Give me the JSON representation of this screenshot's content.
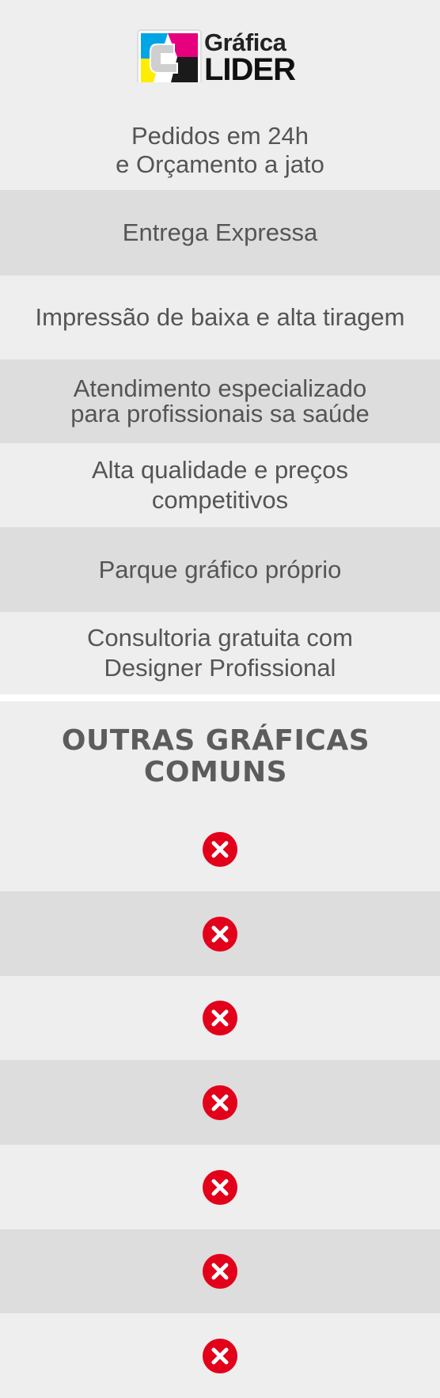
{
  "logo": {
    "line1": "Gráfica",
    "line2": "LIDER",
    "colors": {
      "cyan": "#00a5e3",
      "magenta": "#e6007e",
      "yellow": "#ffed00",
      "black": "#1a1a1a"
    }
  },
  "lider_features": [
    "Pedidos em 24h\ne Orçamento a jato",
    "Entrega Expressa",
    "Impressão de baixa e alta tiragem",
    "Atendimento especializado\npara profissionais sa saúde",
    "Alta qualidade e preços\ncompetitivos",
    "Parque gráfico próprio",
    "Consultoria gratuita com\nDesigner Profissional"
  ],
  "comparison": {
    "heading": "OUTRAS GRÁFICAS\nCOMUNS",
    "icon": "x-circle-icon",
    "icon_color": "#e2001a",
    "rows": 7
  },
  "colors": {
    "light_row": "#eeeeee",
    "dark_row": "#dddddd",
    "text": "#555555"
  }
}
